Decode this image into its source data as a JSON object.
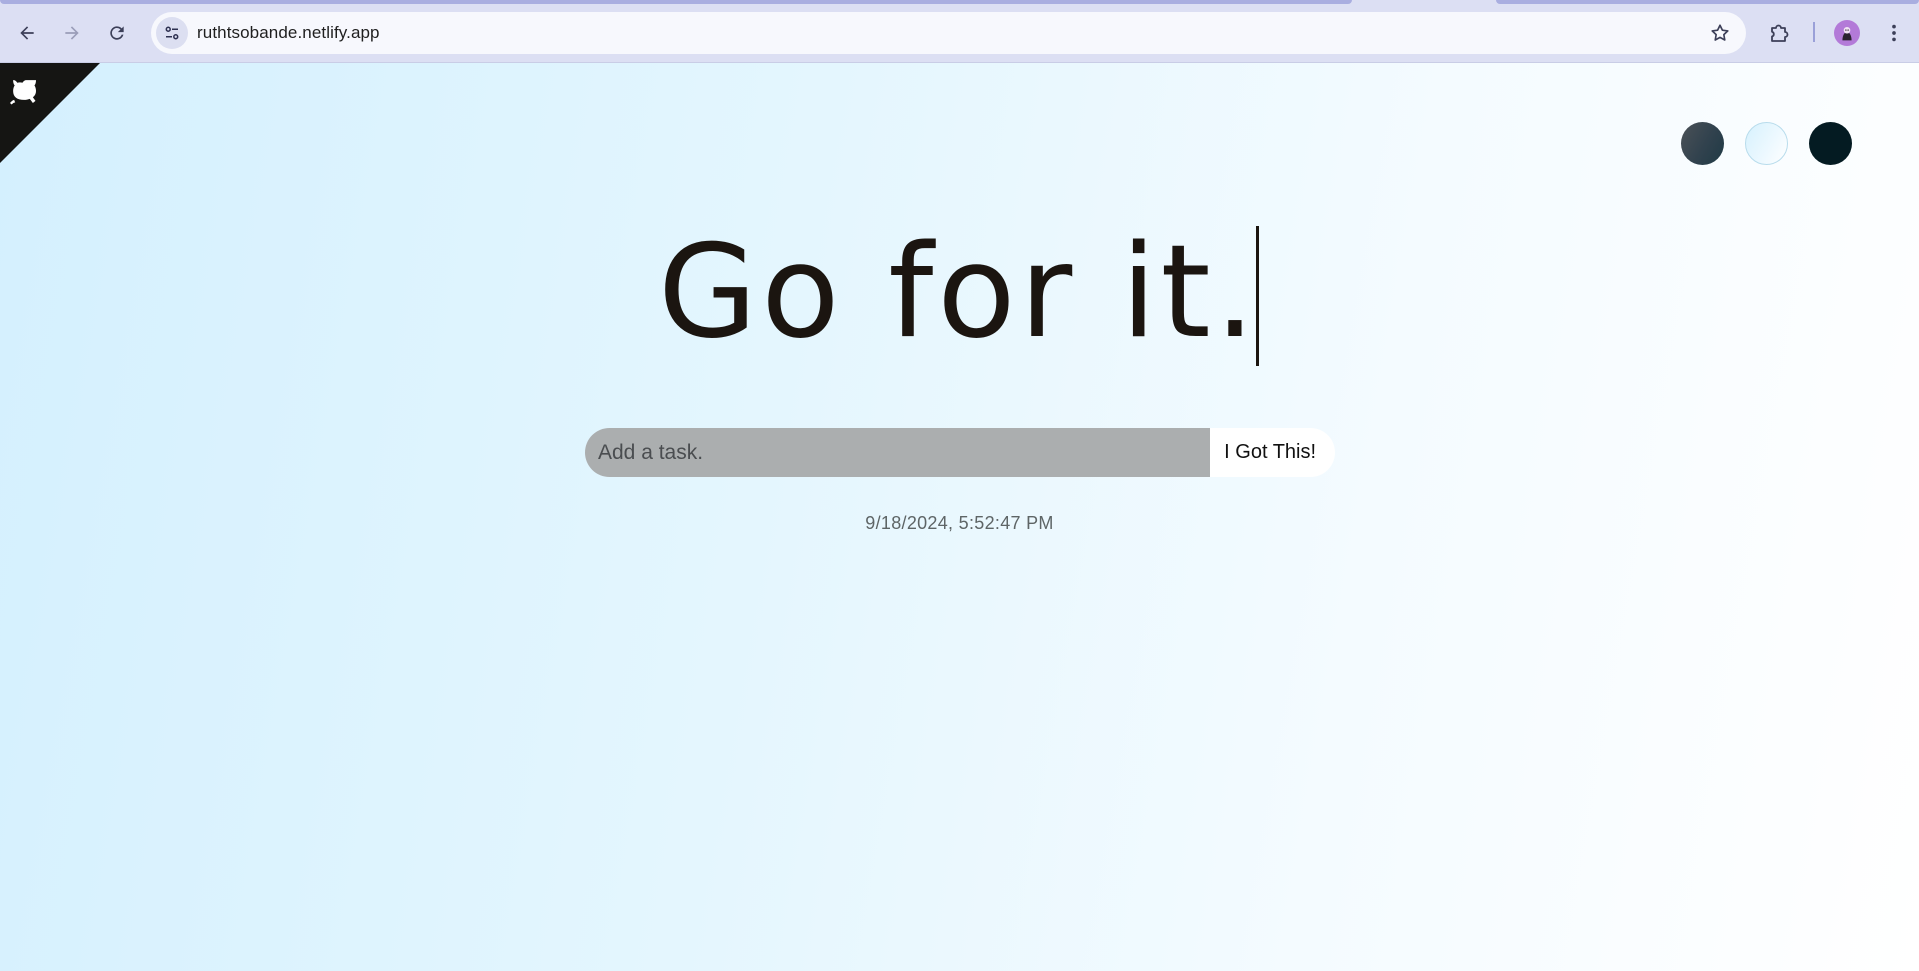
{
  "browser": {
    "url": "ruthtsobande.netlify.app",
    "icons": {
      "back": "arrow-left-icon",
      "forward": "arrow-right-icon",
      "reload": "reload-icon",
      "site_info": "tune-icon",
      "bookmark": "star-icon",
      "extensions": "puzzle-icon",
      "profile": "avatar",
      "menu": "kebab-menu-icon"
    },
    "colors": {
      "chrome_bg": "#dcdff3",
      "omnibox_bg": "#f7f8fd",
      "avatar_bg": "#b37ad8"
    }
  },
  "page": {
    "github_corner_icon": "github-octocat-icon",
    "theme_selectors": [
      {
        "id": "standard",
        "color": "#31424e"
      },
      {
        "id": "light",
        "color": "#eef9ff"
      },
      {
        "id": "darker",
        "color": "#041b22"
      }
    ],
    "heading": "Go for it.",
    "task_input": {
      "placeholder": "Add a task.",
      "value": ""
    },
    "submit_label": "I Got This!",
    "datetime": "9/18/2024, 5:52:47 PM",
    "colors": {
      "background_start": "#d4f0fe",
      "background_end": "#ffffff",
      "heading": "#1b1510",
      "input_bg": "#abaeaf",
      "button_bg": "#ffffff"
    }
  }
}
